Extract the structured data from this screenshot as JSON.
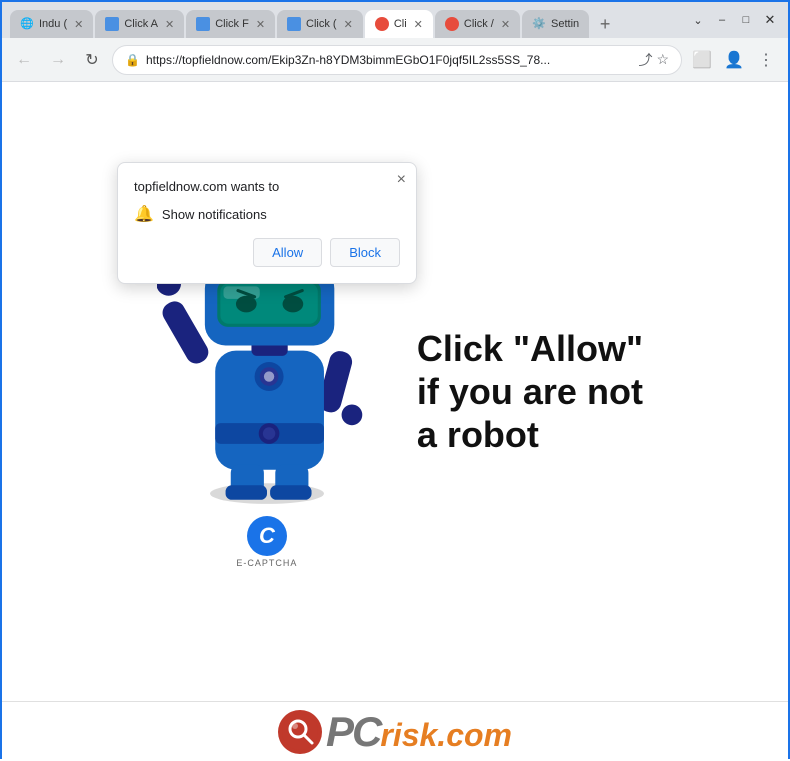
{
  "titlebar": {
    "tabs": [
      {
        "id": "tab1",
        "favicon": "🌐",
        "title": "Indu (",
        "active": false,
        "closeable": true
      },
      {
        "id": "tab2",
        "favicon": "🔵",
        "title": "Click A",
        "active": false,
        "closeable": true
      },
      {
        "id": "tab3",
        "favicon": "🔵",
        "title": "Click F",
        "active": false,
        "closeable": true
      },
      {
        "id": "tab4",
        "favicon": "🔵",
        "title": "Click (",
        "active": false,
        "closeable": true
      },
      {
        "id": "tab5",
        "favicon": "🔴",
        "title": "Cli",
        "active": true,
        "closeable": true
      },
      {
        "id": "tab6",
        "favicon": "🔴",
        "title": "Click /",
        "active": false,
        "closeable": true
      },
      {
        "id": "tab7",
        "favicon": "⚙️",
        "title": "Settin",
        "active": false,
        "closeable": false
      }
    ],
    "new_tab_label": "+",
    "window_controls": {
      "minimize": "–",
      "maximize": "□",
      "close": "✕"
    }
  },
  "addressbar": {
    "back_tooltip": "Back",
    "forward_tooltip": "Forward",
    "reload_tooltip": "Reload",
    "url": "https://topfieldnow.com/Ekip3Zn-h8YDM3bimmEGbO1F0jqf5IL2ss5SS_78...",
    "share_icon": "share",
    "bookmark_icon": "bookmark",
    "extensions_icon": "extensions",
    "profile_icon": "profile",
    "menu_icon": "menu"
  },
  "notification_popup": {
    "title": "topfieldnow.com wants to",
    "permission_item": "Show notifications",
    "allow_label": "Allow",
    "block_label": "Block",
    "close_label": "×"
  },
  "main_content": {
    "cta_text": "Click \"Allow\"\nif you are not\na robot",
    "captcha_label": "E-CAPTCHA",
    "captcha_letter": "C"
  },
  "footer": {
    "brand": "PCrisk.com"
  }
}
